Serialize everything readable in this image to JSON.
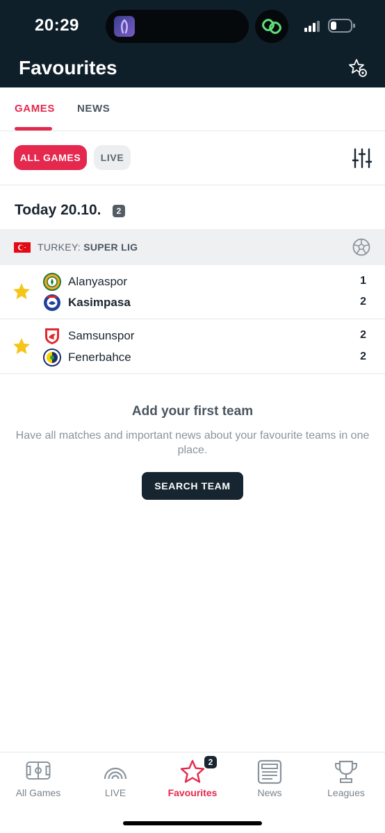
{
  "status_bar": {
    "time": "20:29"
  },
  "header": {
    "title": "Favourites",
    "settings_icon": "star-gear-icon"
  },
  "tabs": [
    {
      "label": "GAMES",
      "active": true
    },
    {
      "label": "NEWS",
      "active": false
    }
  ],
  "filters": {
    "all_games": "ALL GAMES",
    "live": "LIVE",
    "icon": "sliders-icon"
  },
  "date_section": {
    "label": "Today 20.10.",
    "count": "2"
  },
  "league": {
    "country": "TURKEY:",
    "name": "SUPER LIG",
    "sport_icon": "soccer-ball-icon"
  },
  "matches": [
    {
      "favourite": true,
      "home": {
        "name": "Alanyaspor",
        "score": "1",
        "winner": false
      },
      "away": {
        "name": "Kasimpasa",
        "score": "2",
        "winner": true
      }
    },
    {
      "favourite": true,
      "home": {
        "name": "Samsunspor",
        "score": "2",
        "winner": false
      },
      "away": {
        "name": "Fenerbahce",
        "score": "2",
        "winner": false
      }
    }
  ],
  "empty_state": {
    "title": "Add your first team",
    "text": "Have all matches and important news about your favourite teams in one place.",
    "button": "SEARCH TEAM"
  },
  "bottom_nav": {
    "items": [
      {
        "label": "All Games",
        "icon": "pitch-icon"
      },
      {
        "label": "LIVE",
        "icon": "live-icon"
      },
      {
        "label": "Favourites",
        "icon": "star-icon",
        "active": true,
        "badge": "2"
      },
      {
        "label": "News",
        "icon": "news-icon"
      },
      {
        "label": "Leagues",
        "icon": "trophy-icon"
      }
    ]
  },
  "colors": {
    "accent": "#e5284d",
    "header_bg": "#0f1f2a",
    "star": "#f5c518"
  }
}
